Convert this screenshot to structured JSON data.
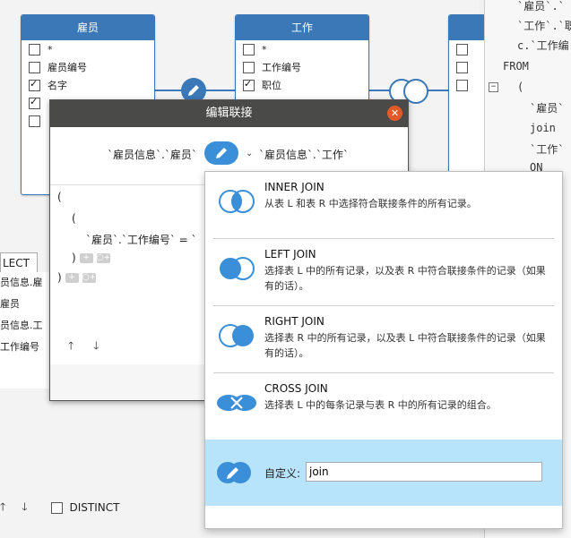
{
  "tables": {
    "employee": {
      "title": "雇员",
      "rows": [
        {
          "label": "*",
          "checked": false
        },
        {
          "label": "雇员编号",
          "checked": false
        },
        {
          "label": "名字",
          "checked": true
        },
        {
          "label": "",
          "checked": true
        },
        {
          "label": "",
          "checked": false
        }
      ]
    },
    "job": {
      "title": "工作",
      "rows": [
        {
          "label": "*",
          "checked": false
        },
        {
          "label": "工作编号",
          "checked": false
        },
        {
          "label": "职位",
          "checked": true
        }
      ]
    }
  },
  "code_lines": [
    "`雇员`.`",
    "`工作`.`职",
    "c.`工作编",
    "FROM",
    "(",
    "`雇员`",
    "join",
    "`工作`",
    "ON"
  ],
  "left_panel": {
    "tab": "LECT",
    "items": [
      "员信息.雇",
      "雇员",
      "员信息.工",
      "工作编号"
    ],
    "distinct_label": "DISTINCT"
  },
  "dialog": {
    "title": "编辑联接",
    "left_table": "`雇员信息`.`雇员`",
    "right_table": "`雇员信息`.`工作`",
    "editor": {
      "open_paren": "(",
      "inner_paren": "(",
      "condition": "`雇员`.`工作编号` = `",
      "close_inner": ")",
      "close_outer": ")"
    }
  },
  "join_options": [
    {
      "name": "INNER JOIN",
      "desc": "从表 L 和表 R 中选择符合联接条件的所有记录。",
      "icon": "inner-join-icon"
    },
    {
      "name": "LEFT JOIN",
      "desc": "选择表 L 中的所有记录，以及表 R 中符合联接条件的记录（如果有的话）。",
      "icon": "left-join-icon"
    },
    {
      "name": "RIGHT JOIN",
      "desc": "选择表 R 中的所有记录，以及表 L 中符合联接条件的记录（如果有的话）。",
      "icon": "right-join-icon"
    },
    {
      "name": "CROSS JOIN",
      "desc": "选择表 L 中的每条记录与表 R 中的所有记录的组合。",
      "icon": "cross-join-icon"
    }
  ],
  "custom_join": {
    "label": "自定义:",
    "value": "join"
  },
  "colors": {
    "accent": "#3a8fd8",
    "selected": "#b7e3fb",
    "table_header": "#3a78b8"
  }
}
